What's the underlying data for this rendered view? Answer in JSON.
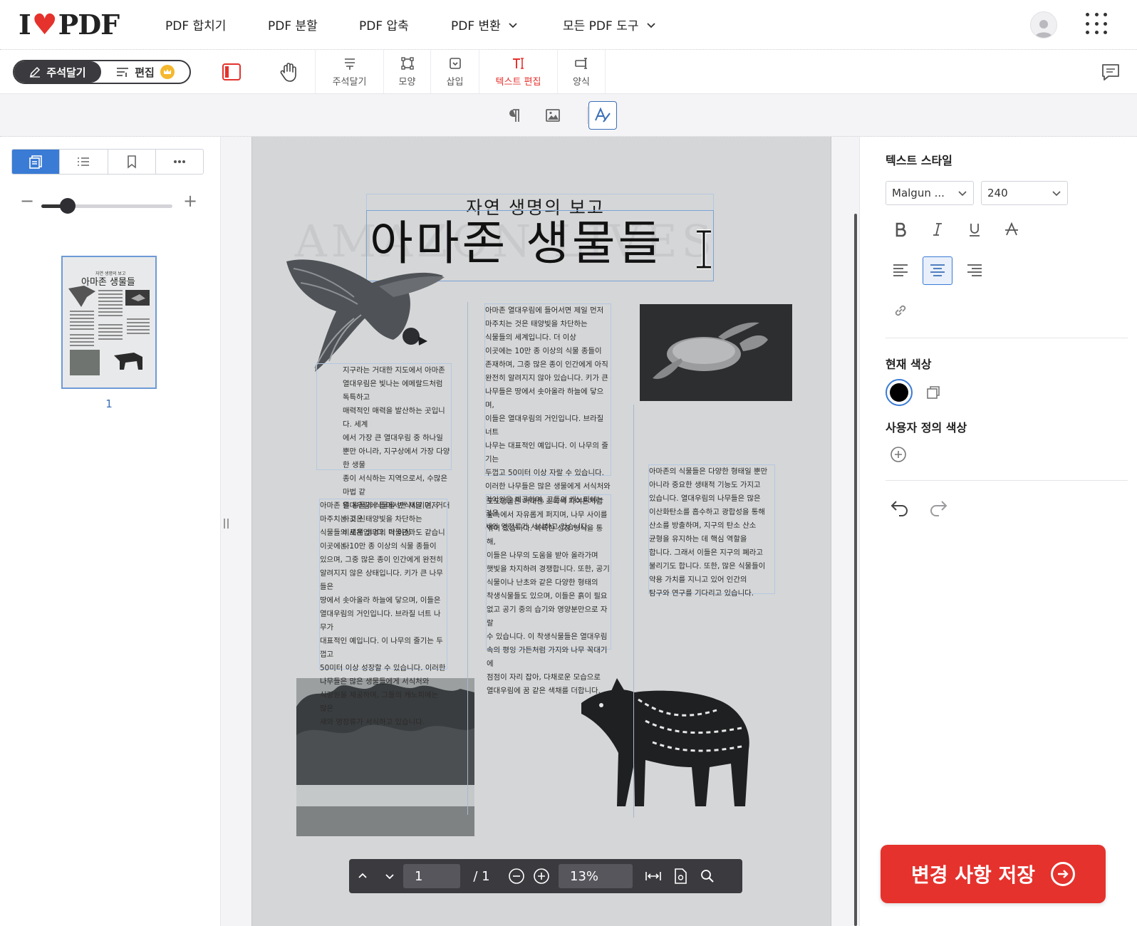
{
  "brand": {
    "logo_left": "I",
    "logo_right": "PDF",
    "accent": "#e5322d"
  },
  "nav": {
    "items": [
      {
        "label": "PDF 합치기"
      },
      {
        "label": "PDF 분할"
      },
      {
        "label": "PDF 압축"
      },
      {
        "label": "PDF 변환"
      },
      {
        "label": "모든 PDF 도구"
      }
    ]
  },
  "toolbar": {
    "mode_annotate": "주석달기",
    "mode_edit": "편집",
    "tools": [
      {
        "label": "주석달기",
        "icon": "annotate-icon"
      },
      {
        "label": "모양",
        "icon": "shape-icon"
      },
      {
        "label": "삽입",
        "icon": "insert-icon"
      },
      {
        "label": "텍스트 편집",
        "icon": "text-edit-icon",
        "active": true
      },
      {
        "label": "양식",
        "icon": "form-icon"
      }
    ]
  },
  "left_panel": {
    "zoom_level": 0.2,
    "thumbnail": {
      "page_label": "1",
      "title": "아마존 생물들",
      "subtitle": "자연 생명의 보고"
    }
  },
  "document": {
    "subtitle": "자연 생명의 보고",
    "title": "아마존 생물들",
    "ghost_text": "AMAZON LIVES",
    "col1_a": "지구라는 거대한 지도에서 아마존\n열대우림은 빛나는 에메랄드처럼 독특하고\n매력적인 매력을 발산하는 곳입니다. 세계\n에서 가장 큰 열대우림 중 하나일\n뿐만 아니라, 지구상에서 가장 다양한 생물\n종이 서식하는 지역으로서, 수많은 마법 같\n은 동물과 식물을 번식시키며, 거대하고 신\n비로운 생명의 박물관과도 같습니다.",
    "col1_b": "아마존 열대우림에 들어서면 제일 먼저\n마주치는 것은 태양빛을 차단하는\n식물들의 세계입니다. 더 이상\n이곳에는 10만 종 이상의 식물 종들이\n있으며, 그중 많은 종이 인간에게 완전히\n알려지지 않은 상태입니다. 키가 큰 나무들은\n땅에서 솟아올라 하늘에 닿으며, 이들은\n열대우림의 거인입니다. 브라질 너트 나무가\n대표적인 예입니다. 이 나무의 줄기는 두껍고\n50미터 이상 성장할 수 있습니다. 이러한\n나무들은 많은 생물들에게 서식처와\n식량원을 제공하며, 그들의 캐노피에는 많은\n새와 영장류가 서식하고 있습니다.",
    "col2_a": "아마존 열대우림에 들어서면 제일 먼저\n마주치는 것은 태양빛을 차단하는\n식물들의 세계입니다. 더 이상\n이곳에는 10만 종 이상의 식물 종들이\n존재하며, 그중 많은 종이 인간에게 아직\n완전히 알려지지 않아 있습니다. 키가 큰\n나무들은 땅에서 솟아올라 하늘에 닿으며,\n이들은 열대우림의 거인입니다. 브라질 너트\n나무는 대표적인 예입니다. 이 나무의 줄기는\n두껍고 50미터 이상 자랄 수 있습니다.\n이러한 나무들은 많은 생물에게 서식처와\n먹이원을 제공하며, 그들의 캐노피에는 많은\n새와 영장류가 서식하고 있습니다.",
    "col2_b": "포도덩굴은 거대한 초록색 파이톤처럼\n숲속에서 자유롭게 퍼지며, 나무 사이를\n엮어 있습니다. 독특한 성장 방식을 통해,\n이들은 나무의 도움을 받아 올라가며\n햇빛을 차지하려 경쟁합니다. 또한, 공기\n식물이나 난초와 같은 다양한 형태의\n착생식물들도 있으며, 이들은 흙이 필요\n없고 공기 중의 습기와 영양분만으로 자랄\n수 있습니다. 이 착생식물들은 열대우림\n속의 평잉 가든처럼 가지와 나무 꼭대기에\n점점이 자리 잡아, 다채로운 모습으로\n열대우림에 꿈 같은 색채를 더합니다.",
    "col3": "아마존의 식물들은 다양한 형태일 뿐만\n아니라 중요한 생태적 기능도 가지고\n있습니다. 열대우림의 나무들은 많은\n이산화탄소를 흡수하고 광합성을 통해\n산소를 방출하며, 지구의 탄소 산소\n균형을 유지하는 데 핵심 역할을\n합니다. 그래서 이들은 지구의 폐라고\n불리기도 합니다. 또한, 많은 식물들이\n약용 가치를 지니고 있어 인간의\n탐구와 연구를 기다리고 있습니다."
  },
  "page_nav": {
    "current_page": "1",
    "total": "/ 1",
    "zoom": "13%"
  },
  "right_panel": {
    "text_style_heading": "텍스트 스타일",
    "font_family": "Malgun ...",
    "font_size": "240",
    "current_color_heading": "현재 색상",
    "current_color": "#000000",
    "custom_color_heading": "사용자 정의 색상",
    "alignment": "center"
  },
  "save_button": {
    "label": "변경 사항 저장"
  }
}
